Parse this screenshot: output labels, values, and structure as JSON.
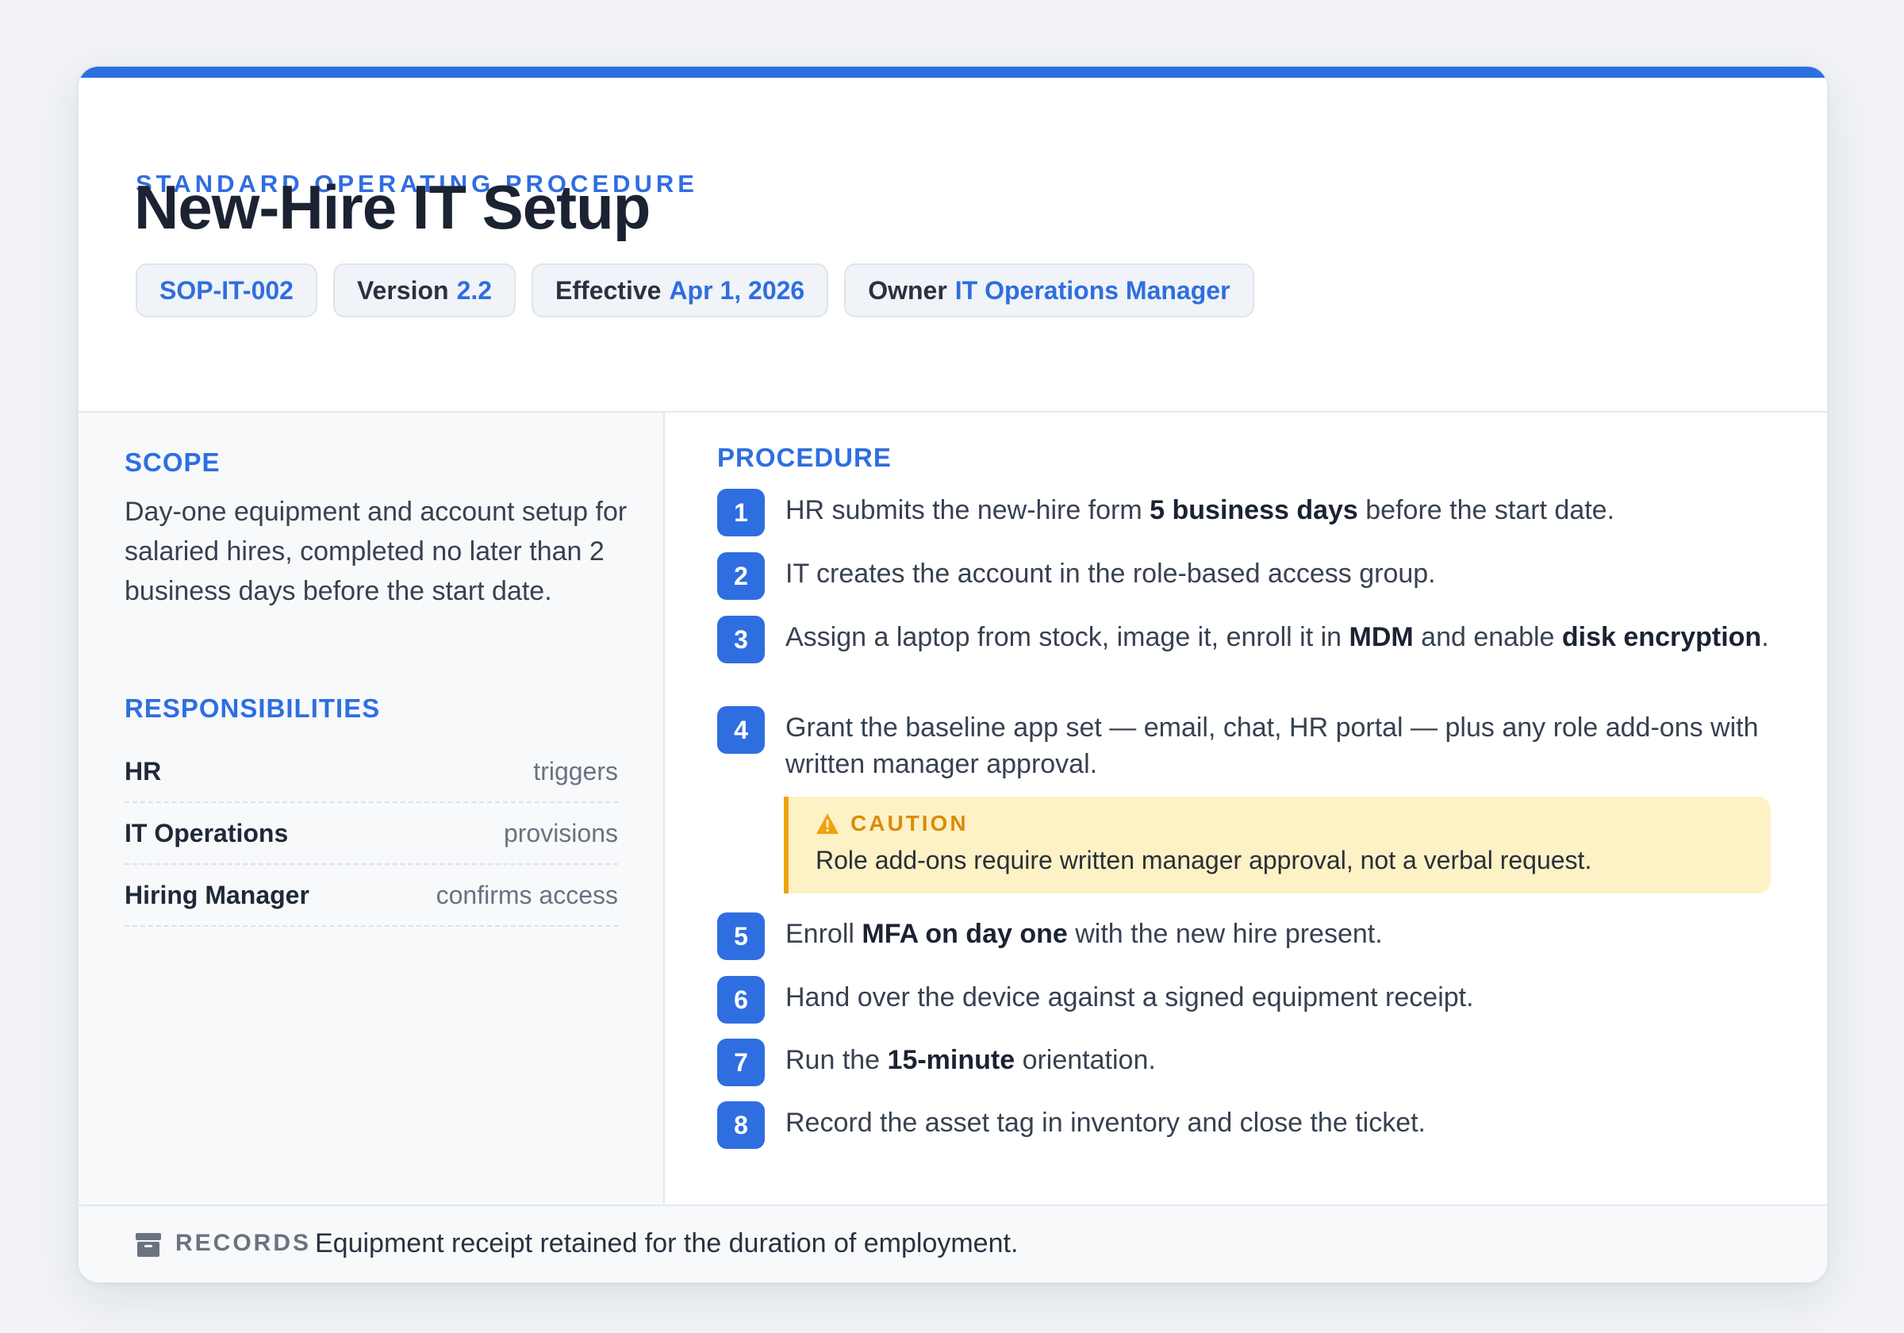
{
  "header": {
    "eyebrow": "STANDARD OPERATING PROCEDURE",
    "title": "New-Hire IT Setup",
    "chips": {
      "id": "SOP-IT-002",
      "version_label": "Version",
      "version_value": "2.2",
      "effective_label": "Effective",
      "effective_value": "Apr 1, 2026",
      "owner_label": "Owner",
      "owner_value": "IT Operations Manager"
    }
  },
  "scope": {
    "heading": "SCOPE",
    "text": "Day-one equipment and account setup for salaried hires, completed no later than 2 business days before the start date."
  },
  "responsibilities": {
    "heading": "RESPONSIBILITIES",
    "rows": [
      {
        "role": "HR",
        "action": "triggers"
      },
      {
        "role": "IT Operations",
        "action": "provisions"
      },
      {
        "role": "Hiring Manager",
        "action": "confirms access"
      }
    ]
  },
  "procedure": {
    "heading": "PROCEDURE",
    "steps": [
      {
        "num": "1",
        "parts": [
          [
            "HR submits the new-hire form ",
            false
          ],
          [
            "5 business days",
            true
          ],
          [
            " before the start date.",
            false
          ]
        ]
      },
      {
        "num": "2",
        "parts": [
          [
            "IT creates the account in the role-based access group.",
            false
          ]
        ]
      },
      {
        "num": "3",
        "parts": [
          [
            "Assign a laptop from stock, image it, enroll it in ",
            false
          ],
          [
            "MDM",
            true
          ],
          [
            " and enable ",
            false
          ],
          [
            "disk encryption",
            true
          ],
          [
            ".",
            false
          ]
        ]
      },
      {
        "num": "4",
        "parts": [
          [
            "Grant the baseline app set — email, chat, HR portal — plus any role add-ons with written manager approval.",
            false
          ]
        ]
      },
      {
        "num": "5",
        "parts": [
          [
            "Enroll ",
            false
          ],
          [
            "MFA on day one",
            true
          ],
          [
            " with the new hire present.",
            false
          ]
        ]
      },
      {
        "num": "6",
        "parts": [
          [
            "Hand over the device against a signed equipment receipt.",
            false
          ]
        ]
      },
      {
        "num": "7",
        "parts": [
          [
            "Run the ",
            false
          ],
          [
            "15-minute",
            true
          ],
          [
            " orientation.",
            false
          ]
        ]
      },
      {
        "num": "8",
        "parts": [
          [
            "Record the asset tag in inventory and close the ticket.",
            false
          ]
        ]
      }
    ],
    "caution": {
      "label": "CAUTION",
      "text": "Role add-ons require written manager approval, not a verbal request."
    }
  },
  "records": {
    "label": "RECORDS",
    "text": "Equipment receipt retained for the duration of employment."
  },
  "colors": {
    "accent": "#2f6ee0",
    "caution_bg": "#fdf1c6",
    "caution_accent": "#f0a20b"
  },
  "icons": {
    "caution": "warning-triangle-icon",
    "records": "archive-box-icon"
  }
}
